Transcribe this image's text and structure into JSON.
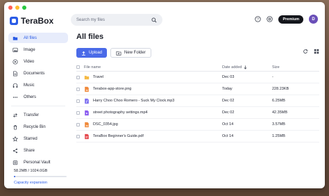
{
  "app": {
    "name": "TeraBox"
  },
  "search": {
    "placeholder": "Search my files"
  },
  "header": {
    "premium_label": "Premium",
    "avatar_initial": "D"
  },
  "sidebar": {
    "items": [
      {
        "label": "All files",
        "icon": "folder-icon",
        "active": true
      },
      {
        "label": "Image",
        "icon": "image-icon"
      },
      {
        "label": "Video",
        "icon": "video-icon"
      },
      {
        "label": "Documents",
        "icon": "document-icon"
      },
      {
        "label": "Music",
        "icon": "music-icon"
      },
      {
        "label": "Others",
        "icon": "more-icon"
      }
    ],
    "items2": [
      {
        "label": "Transfer",
        "icon": "transfer-icon"
      },
      {
        "label": "Recycle Bin",
        "icon": "trash-icon"
      },
      {
        "label": "Starred",
        "icon": "star-icon"
      },
      {
        "label": "Share",
        "icon": "share-icon"
      },
      {
        "label": "Personal Vault",
        "icon": "vault-icon"
      }
    ],
    "storage": {
      "text": "58.2MB / 1024.0GB",
      "used_fraction": 0.0001,
      "expand_label": "Capacity expansion"
    }
  },
  "main": {
    "title": "All files",
    "upload_label": "Upload",
    "new_folder_label": "New Folder",
    "columns": {
      "name": "File name",
      "date": "Date added",
      "size": "Size"
    },
    "files": [
      {
        "name": "Travel",
        "date": "Dec 03",
        "size": "-",
        "type": "folder"
      },
      {
        "name": "Terabox-app-store.png",
        "date": "Today",
        "size": "228.23KB",
        "type": "image"
      },
      {
        "name": "Harry Choo Choo Romero - Suck My Clock.mp3",
        "date": "Dec 02",
        "size": "6.25MB",
        "type": "audio"
      },
      {
        "name": "street photography settings.mp4",
        "date": "Dec 02",
        "size": "42.35MB",
        "type": "video"
      },
      {
        "name": "DSC_0354.jpg",
        "date": "Oct 14",
        "size": "3.57MB",
        "type": "image"
      },
      {
        "name": "TeraBox Beginner's Guide.pdf",
        "date": "Oct 14",
        "size": "1.25MB",
        "type": "pdf"
      }
    ]
  },
  "colors": {
    "accent": "#2b5ce6",
    "upload": "#4a6ae8",
    "folder": "#f5b944",
    "image": "#f08a3c",
    "audio": "#7a6cf0",
    "video": "#8a5cf0",
    "pdf": "#e5484d"
  }
}
